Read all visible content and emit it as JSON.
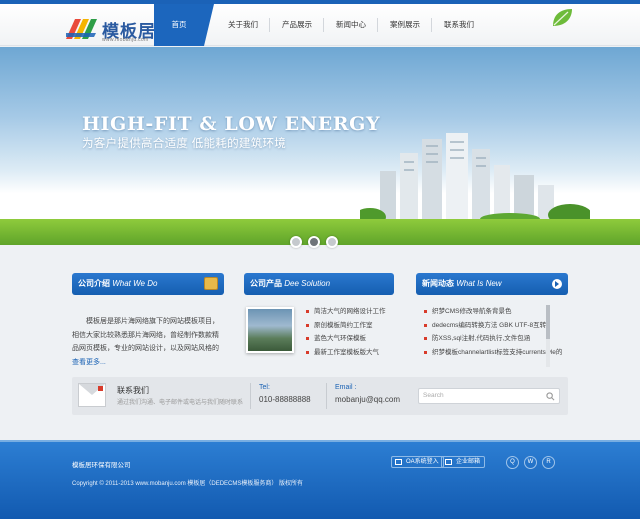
{
  "header": {
    "logo_text": "模板居",
    "logo_sub": "www.mobanju.com",
    "nav": [
      {
        "label": "首页",
        "active": true
      },
      {
        "label": "关于我们"
      },
      {
        "label": "产品展示"
      },
      {
        "label": "新闻中心"
      },
      {
        "label": "案例展示"
      },
      {
        "label": "联系我们"
      }
    ]
  },
  "banner": {
    "headline": "HIGH-FIT & LOW ENERGY",
    "tagline": "为客户提供高合适度 低能耗的建筑环境",
    "slides": 3,
    "active_slide": 2
  },
  "about": {
    "title_cn": "公司介绍",
    "title_en": "What We Do",
    "text": "模板居是那片海网络旗下的网站模板项目，相信大家比较熟悉那片海网络，曾经制作数款精品网页模板，专业的网站设计，以及网站风格的",
    "more": "查看更多..."
  },
  "products": {
    "title_cn": "公司产品",
    "title_en": "Dee Solution",
    "items": [
      "简洁大气的网络设计工作",
      "原创模板简约工作室",
      "蓝色大气环保模板",
      "最新工作室模板版大气"
    ]
  },
  "news": {
    "title_cn": "新闻动态",
    "title_en": "What Is New",
    "items": [
      "织梦CMS修改导航条背景色",
      "dedecms编码转换方法 GBK UTF-8互转",
      "防XSS,sql注射,代码执行,文件包涵",
      "织梦模板channelartlist标签支持currentstyle的"
    ]
  },
  "contact": {
    "title": "联系我们",
    "desc": "通过我们沟通、电子邮件或电话与我们随时联系",
    "tel_label": "Tel:",
    "tel_value": "010-88888888",
    "email_label": "Email :",
    "email_value": "mobanju@qq.com",
    "search_placeholder": "Search"
  },
  "footer": {
    "company": "模板居环保有限公司",
    "copyright": "Copyright © 2011-2013 www.mobanju.com 模板居（DEDECMS模板服务商） 版权所有",
    "btn_oa": "OA系统登入",
    "btn_mail": "企业邮箱"
  },
  "colors": {
    "primary": "#1c66bd",
    "footer": "#1a62b4",
    "bullet": "#d83b2b"
  }
}
